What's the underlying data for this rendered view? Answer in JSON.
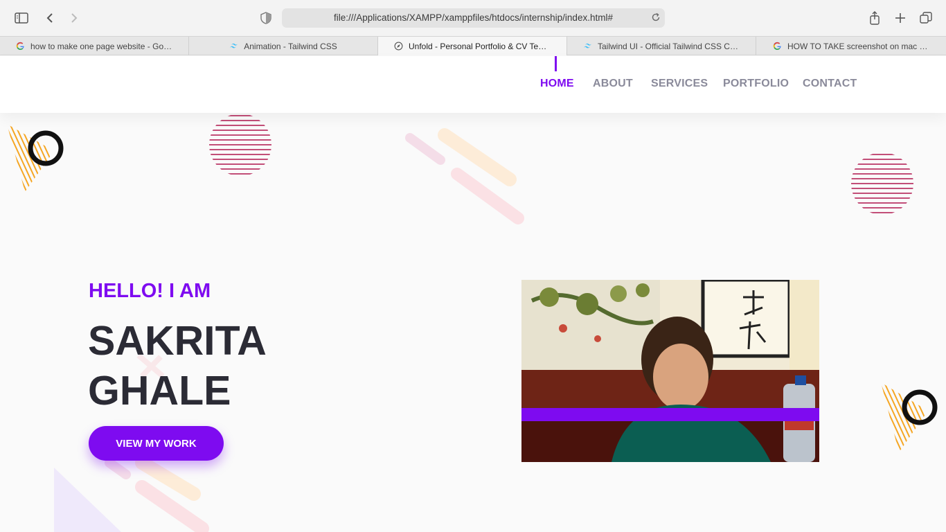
{
  "browser": {
    "url": "file:///Applications/XAMPP/xamppfiles/htdocs/internship/index.html#",
    "tabs": [
      {
        "label": "how to make one page website - Goog...",
        "favicon": "google-icon",
        "active": false
      },
      {
        "label": "Animation - Tailwind CSS",
        "favicon": "tailwind-icon",
        "active": false
      },
      {
        "label": "Unfold - Personal Portfolio & CV Tem...",
        "favicon": "compass-icon",
        "active": true
      },
      {
        "label": "Tailwind UI - Official Tailwind CSS Co...",
        "favicon": "tailwind-icon",
        "active": false
      },
      {
        "label": "HOW TO TAKE screenshot on mac - G...",
        "favicon": "google-icon",
        "active": false
      }
    ]
  },
  "nav": {
    "items": [
      "HOME",
      "ABOUT",
      "SERVICES",
      "PORTFOLIO",
      "CONTACT"
    ],
    "active": "HOME"
  },
  "hero": {
    "greeting": "HELLO! I AM",
    "first_name": "SAKRITA",
    "last_name": "GHALE",
    "cta_label": "VIEW MY WORK"
  },
  "colors": {
    "accent": "#7e0bf0",
    "heading": "#2b2b35",
    "nav_inactive": "#8a8a9a"
  }
}
